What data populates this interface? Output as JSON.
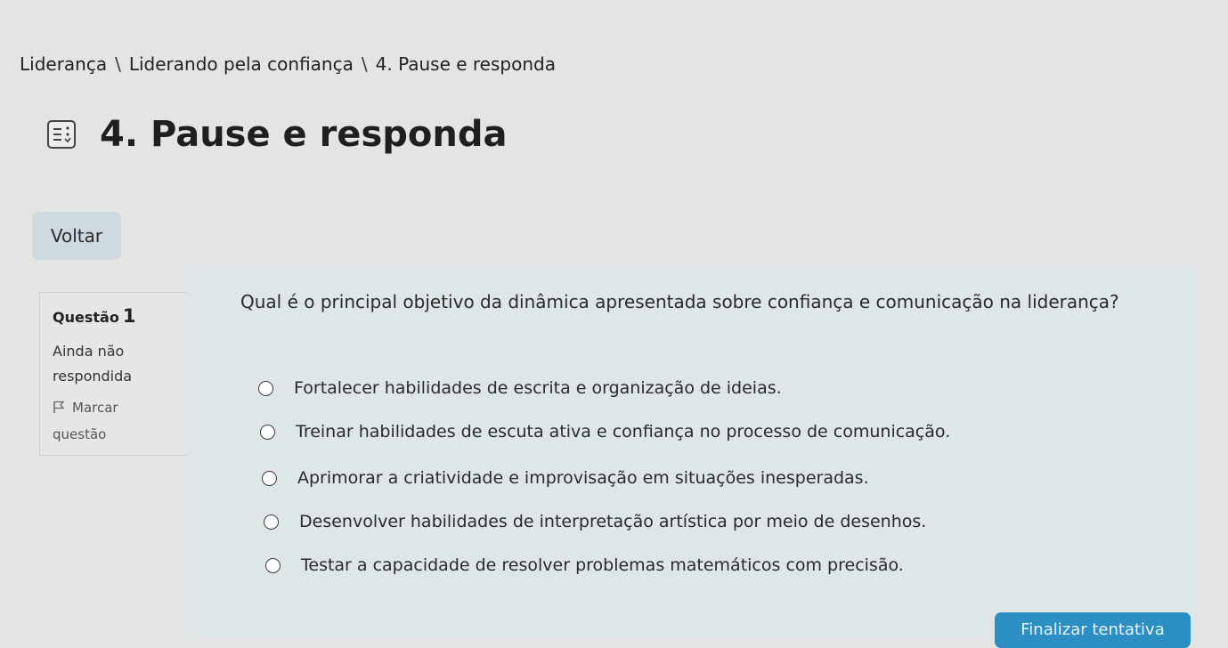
{
  "breadcrumb": {
    "items": [
      "Liderança",
      "Liderando pela confiança",
      "4. Pause e responda"
    ],
    "separator": "\\"
  },
  "page": {
    "title": "4. Pause e responda",
    "title_icon": "quiz-icon"
  },
  "actions": {
    "back_label": "Voltar",
    "finish_label": "Finalizar tentativa"
  },
  "question_info": {
    "label": "Questão",
    "number": "1",
    "state_line1": "Ainda não",
    "state_line2": "respondida",
    "flag_line1": "Marcar",
    "flag_line2": "questão",
    "flag_icon": "flag-icon"
  },
  "question": {
    "text": "Qual é o principal objetivo da dinâmica apresentada sobre confiança e comunicação na liderança?",
    "answers": [
      "Fortalecer habilidades de escrita e organização de ideias.",
      "Treinar habilidades de escuta ativa e confiança no processo de comunicação.",
      "Aprimorar a criatividade e improvisação em situações inesperadas.",
      "Desenvolver habilidades de interpretação artística por meio de desenhos.",
      "Testar a capacidade de resolver problemas matemáticos com precisão."
    ]
  },
  "colors": {
    "page_background": "#e4e4e2",
    "panel_background": "#dfe6e8",
    "back_button": "#cfd9e0",
    "primary_button": "#2b8fc4"
  }
}
